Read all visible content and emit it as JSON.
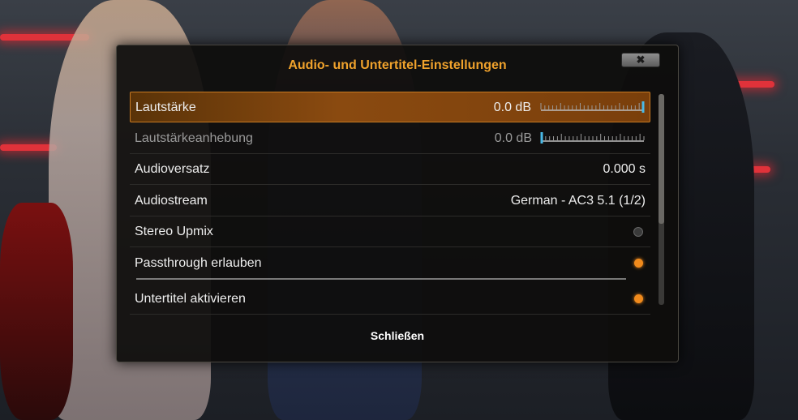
{
  "dialog": {
    "title": "Audio- und Untertitel-Einstellungen",
    "close_icon": "close-icon",
    "close_glyph": "✖",
    "footer_button": "Schließen"
  },
  "settings": [
    {
      "label": "Lautstärke",
      "value": "0.0 dB",
      "type": "slider",
      "level": 1.0,
      "selected": true,
      "enabled": true
    },
    {
      "label": "Lautstärkeanhebung",
      "value": "0.0 dB",
      "type": "slider",
      "level": 0.0,
      "selected": false,
      "enabled": false
    },
    {
      "label": "Audioversatz",
      "value": "0.000 s",
      "type": "text",
      "selected": false,
      "enabled": true
    },
    {
      "label": "Audiostream",
      "value": "German - AC3 5.1 (1/2)",
      "type": "text",
      "selected": false,
      "enabled": true
    },
    {
      "label": "Stereo Upmix",
      "type": "toggle",
      "on": false,
      "selected": false,
      "enabled": true
    },
    {
      "label": "Passthrough erlauben",
      "type": "toggle",
      "on": true,
      "selected": false,
      "enabled": true
    },
    {
      "label": "Untertitel aktivieren",
      "type": "toggle",
      "on": true,
      "selected": false,
      "enabled": true
    }
  ],
  "colors": {
    "accent": "#f0a22c",
    "toggle_on": "#f08a1c",
    "slider_marker": "#49b9e6"
  }
}
